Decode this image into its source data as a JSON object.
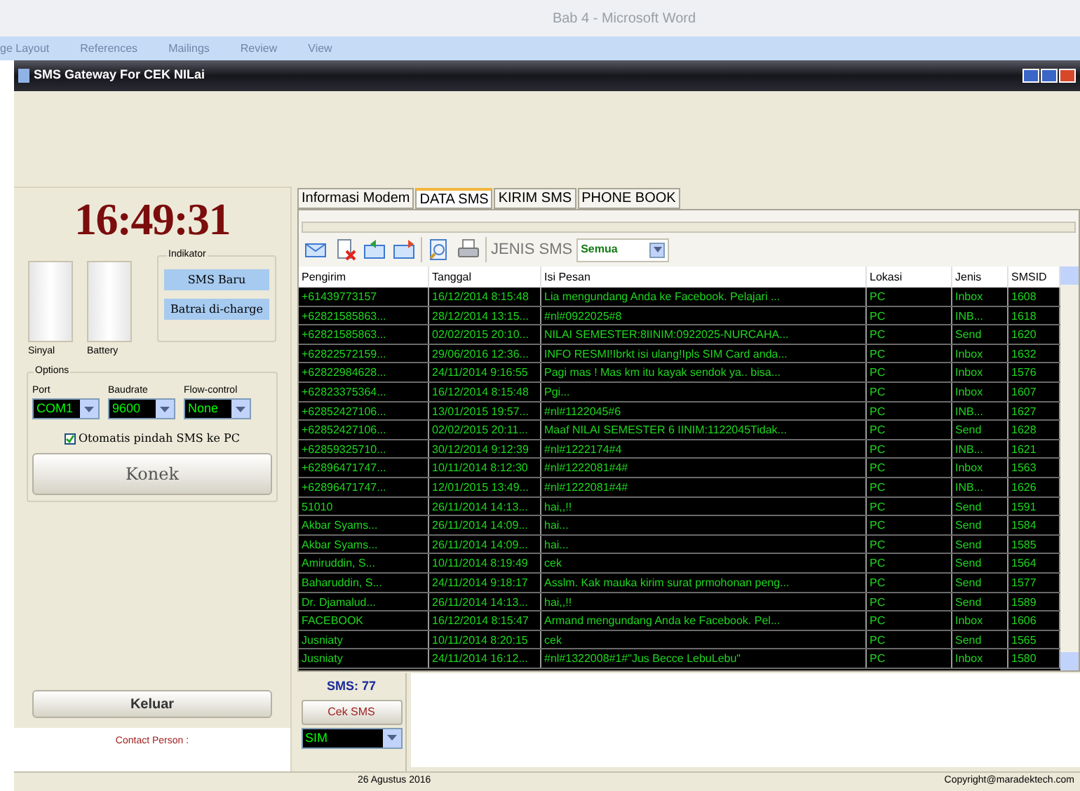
{
  "word_window": {
    "title": "Bab 4 - Microsoft Word",
    "ribbon_tabs": [
      "ge Layout",
      "References",
      "Mailings",
      "Review",
      "View"
    ]
  },
  "window": {
    "title": "SMS Gateway For CEK NILai"
  },
  "clock": "16:49:31",
  "meters": [
    {
      "label": "Sinyal"
    },
    {
      "label": "Battery"
    }
  ],
  "indicator": {
    "title": "Indikator",
    "items": [
      "SMS Baru",
      "Batrai di-charge"
    ]
  },
  "options": {
    "title": "Options",
    "fields": [
      {
        "label": "Port",
        "value": "COM1"
      },
      {
        "label": "Baudrate",
        "value": "9600"
      },
      {
        "label": "Flow-control",
        "value": "None"
      }
    ],
    "auto_move": {
      "label": "Otomatis pindah SMS ke PC",
      "checked": true
    },
    "connect_button": "Konek"
  },
  "exit_button": "Keluar",
  "contact": "Contact Person :",
  "tabs": [
    {
      "label": "Informasi Modem",
      "selected": false
    },
    {
      "label": "DATA SMS",
      "selected": true
    },
    {
      "label": "KIRIM SMS",
      "selected": false
    },
    {
      "label": "PHONE BOOK",
      "selected": false
    }
  ],
  "toolbar": {
    "filter_label": "JENIS SMS",
    "filter_value": "Semua"
  },
  "table": {
    "columns": [
      "Pengirim",
      "Tanggal",
      "Isi Pesan",
      "Lokasi",
      "Jenis",
      "SMSID"
    ],
    "rows": [
      [
        "+61439773157",
        "16/12/2014 8:15:48",
        "Lia mengundang Anda ke Facebook. Pelajari ...",
        "PC",
        "Inbox",
        "1608"
      ],
      [
        "+62821585863...",
        "28/12/2014 13:15...",
        "#nl#0922025#8",
        "PC",
        "INB...",
        "1618"
      ],
      [
        "+62821585863...",
        "02/02/2015 20:10...",
        "NILAI SEMESTER:8IINIM:0922025-NURCAHA...",
        "PC",
        "Send",
        "1620"
      ],
      [
        "+62822572159...",
        "29/06/2016 12:36...",
        "INFO RESMI!Ibrkt isi ulang!Ipls SIM Card anda...",
        "PC",
        "Inbox",
        "1632"
      ],
      [
        "+62822984628...",
        "24/11/2014 9:16:55",
        "Pagi mas ! Mas km itu kayak sendok ya.. bisa...",
        "PC",
        "Inbox",
        "1576"
      ],
      [
        "+62823375364...",
        "16/12/2014 8:15:48",
        "Pgi...",
        "PC",
        "Inbox",
        "1607"
      ],
      [
        "+62852427106...",
        "13/01/2015 19:57...",
        "#nl#1122045#6",
        "PC",
        "INB...",
        "1627"
      ],
      [
        "+62852427106...",
        "02/02/2015 20:11...",
        "Maaf NILAI SEMESTER 6 IINIM:1122045Tidak...",
        "PC",
        "Send",
        "1628"
      ],
      [
        "+62859325710...",
        "30/12/2014 9:12:39",
        "#nl#1222174#4",
        "PC",
        "INB...",
        "1621"
      ],
      [
        "+62896471747...",
        "10/11/2014 8:12:30",
        "#nl#1222081#4#",
        "PC",
        "Inbox",
        "1563"
      ],
      [
        "+62896471747...",
        "12/01/2015 13:49...",
        "#nl#1222081#4#",
        "PC",
        "INB...",
        "1626"
      ],
      [
        "51010",
        "26/11/2014 14:13...",
        "hai,,!!",
        "PC",
        "Send",
        "1591"
      ],
      [
        "Akbar Syams...",
        "26/11/2014 14:09...",
        "hai...",
        "PC",
        "Send",
        "1584"
      ],
      [
        "Akbar Syams...",
        "26/11/2014 14:09...",
        "hai...",
        "PC",
        "Send",
        "1585"
      ],
      [
        "Amiruddin, S...",
        "10/11/2014 8:19:49",
        "cek",
        "PC",
        "Send",
        "1564"
      ],
      [
        "Baharuddin, S...",
        "24/11/2014 9:18:17",
        "Asslm. Kak mauka kirim surat prmohonan peng...",
        "PC",
        "Send",
        "1577"
      ],
      [
        "Dr. Djamalud...",
        "26/11/2014 14:13...",
        "hai,,!!",
        "PC",
        "Send",
        "1589"
      ],
      [
        "FACEBOOK",
        "16/12/2014 8:15:47",
        "Armand mengundang Anda ke Facebook. Pel...",
        "PC",
        "Inbox",
        "1606"
      ],
      [
        "Jusniaty",
        "10/11/2014 8:20:15",
        "cek",
        "PC",
        "Send",
        "1565"
      ],
      [
        "Jusniaty",
        "24/11/2014 16:12...",
        "#nl#1322008#1#\"Jus Becce LebuLebu\"",
        "PC",
        "Inbox",
        "1580"
      ]
    ]
  },
  "sms_panel": {
    "count": "SMS: 77",
    "check_button": "Cek SMS",
    "storage": "SIM"
  },
  "status_bar": {
    "date": "26 Agustus 2016",
    "copyright": "Copyright@maradektech.com"
  }
}
